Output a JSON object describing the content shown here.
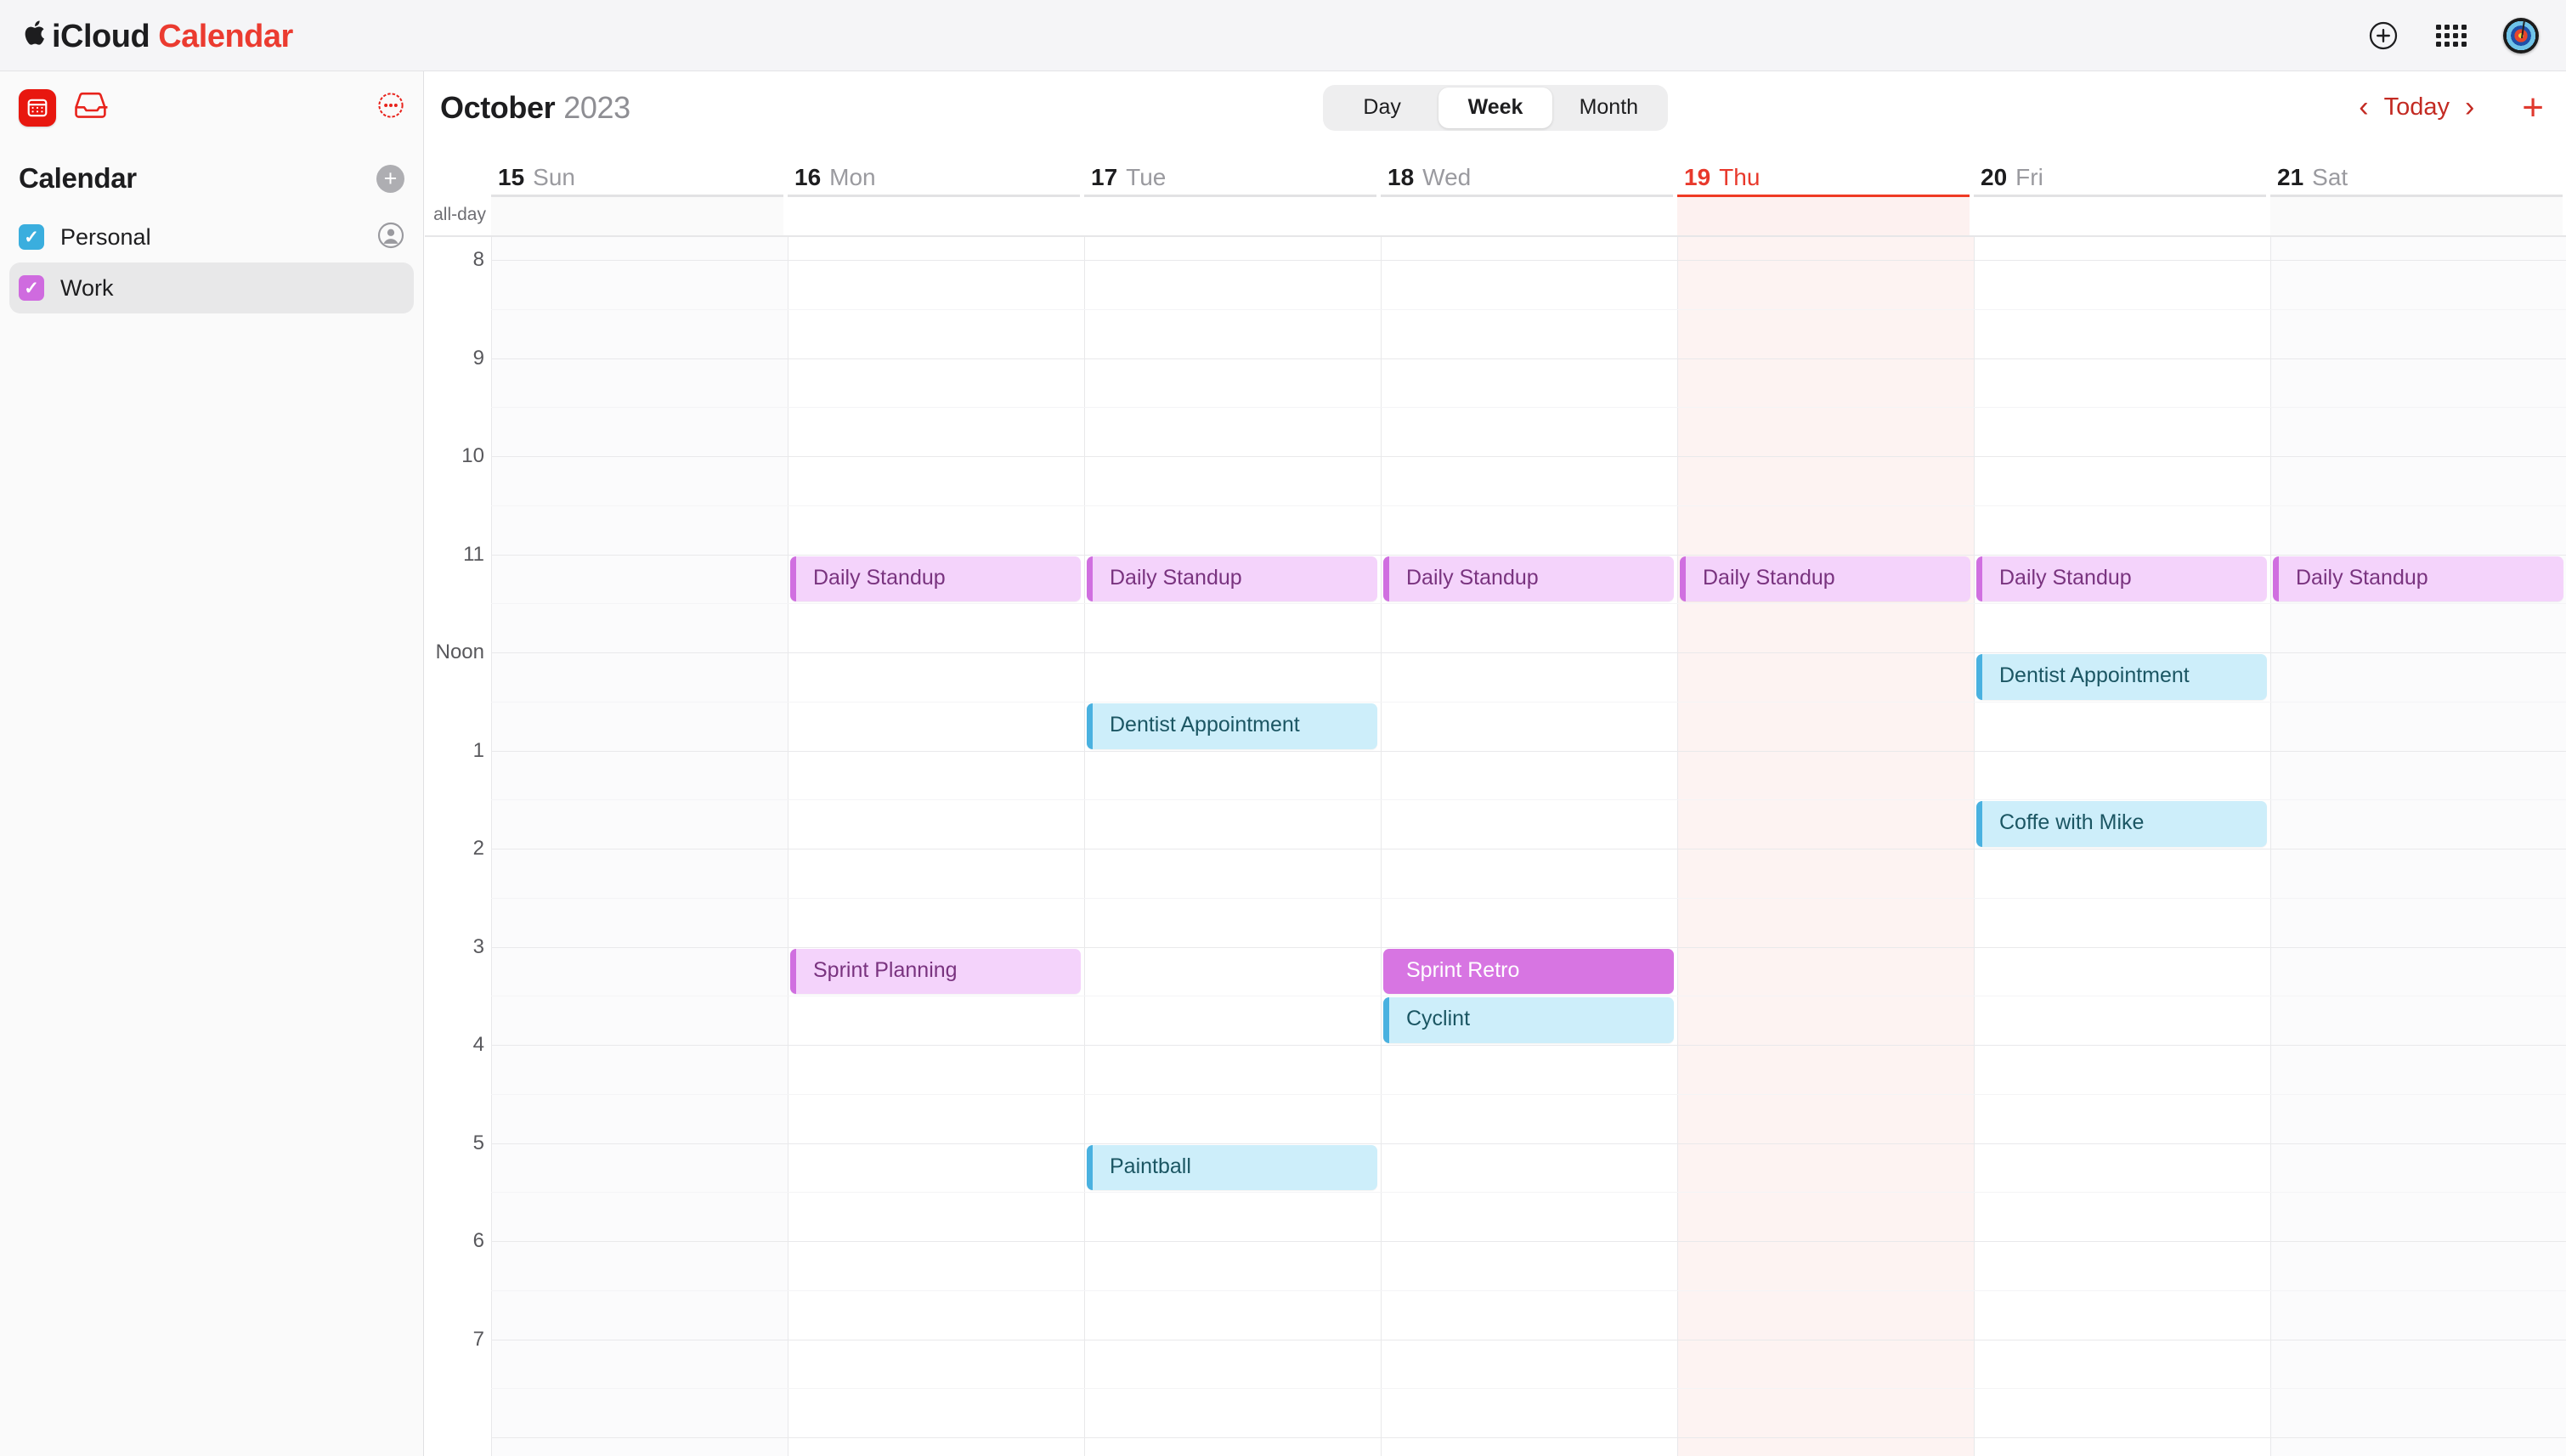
{
  "app": {
    "brand_apple": "",
    "brand_icloud": "iCloud",
    "brand_product": "Calendar"
  },
  "topbar": {
    "add_label": "+",
    "apps_icon": "grid-apps-icon",
    "avatar_icon": "dartboard-avatar"
  },
  "sidebar": {
    "app_icon": "calendar-app-icon",
    "inbox_icon": "inbox-icon",
    "more_icon": "more-circle-icon",
    "heading": "Calendar",
    "add_calendar_label": "+",
    "calendars": [
      {
        "name": "Personal",
        "color": "#3aaede",
        "checked": true,
        "shared": true,
        "selected": false
      },
      {
        "name": "Work",
        "color": "#cf6bdf",
        "checked": true,
        "shared": false,
        "selected": true
      }
    ]
  },
  "toolbar": {
    "month": "October",
    "year": "2023",
    "views": [
      {
        "label": "Day",
        "active": false
      },
      {
        "label": "Week",
        "active": true
      },
      {
        "label": "Month",
        "active": false
      }
    ],
    "prev_label": "‹",
    "today_label": "Today",
    "next_label": "›",
    "add_event_label": "+"
  },
  "calendar_grid": {
    "allday_label": "all-day",
    "hours": [
      "8",
      "9",
      "10",
      "11",
      "Noon",
      "1",
      "2",
      "3",
      "4",
      "5",
      "6",
      "7"
    ],
    "days": [
      {
        "num": "15",
        "dow": "Sun",
        "today": false,
        "weekend": true
      },
      {
        "num": "16",
        "dow": "Mon",
        "today": false,
        "weekend": false
      },
      {
        "num": "17",
        "dow": "Tue",
        "today": false,
        "weekend": false
      },
      {
        "num": "18",
        "dow": "Wed",
        "today": false,
        "weekend": false
      },
      {
        "num": "19",
        "dow": "Thu",
        "today": true,
        "weekend": false
      },
      {
        "num": "20",
        "dow": "Fri",
        "today": false,
        "weekend": false
      },
      {
        "num": "21",
        "dow": "Sat",
        "today": false,
        "weekend": true
      }
    ],
    "events": [
      {
        "title": "Daily Standup",
        "day": 1,
        "start": 11.0,
        "end": 11.5,
        "cal": "work",
        "selected": false
      },
      {
        "title": "Daily Standup",
        "day": 2,
        "start": 11.0,
        "end": 11.5,
        "cal": "work",
        "selected": false
      },
      {
        "title": "Daily Standup",
        "day": 3,
        "start": 11.0,
        "end": 11.5,
        "cal": "work",
        "selected": false
      },
      {
        "title": "Daily Standup",
        "day": 4,
        "start": 11.0,
        "end": 11.5,
        "cal": "work",
        "selected": false
      },
      {
        "title": "Daily Standup",
        "day": 5,
        "start": 11.0,
        "end": 11.5,
        "cal": "work",
        "selected": false
      },
      {
        "title": "Daily Standup",
        "day": 6,
        "start": 11.0,
        "end": 11.5,
        "cal": "work",
        "selected": false
      },
      {
        "title": "Dentist Appointment",
        "day": 5,
        "start": 12.0,
        "end": 12.5,
        "cal": "personal",
        "selected": false
      },
      {
        "title": "Dentist Appointment",
        "day": 2,
        "start": 12.5,
        "end": 13.0,
        "cal": "personal",
        "selected": false
      },
      {
        "title": "Coffe with Mike",
        "day": 5,
        "start": 13.5,
        "end": 14.0,
        "cal": "personal",
        "selected": false
      },
      {
        "title": "Sprint Planning",
        "day": 1,
        "start": 15.0,
        "end": 15.5,
        "cal": "work",
        "selected": false
      },
      {
        "title": "Sprint Retro",
        "day": 3,
        "start": 15.0,
        "end": 15.5,
        "cal": "work",
        "selected": true
      },
      {
        "title": "Cyclint",
        "day": 3,
        "start": 15.5,
        "end": 16.0,
        "cal": "personal",
        "selected": false
      },
      {
        "title": "Paintball",
        "day": 2,
        "start": 17.0,
        "end": 17.5,
        "cal": "personal",
        "selected": false
      }
    ]
  }
}
